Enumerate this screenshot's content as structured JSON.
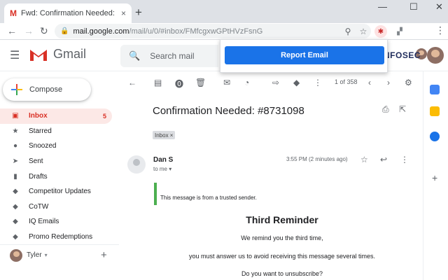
{
  "browser": {
    "tab_title": "Fwd: Confirmation Needed: tyler",
    "tab_close": "×",
    "new_tab": "+",
    "window_controls": {
      "minimize": "—",
      "maximize": "☐",
      "close": "✕"
    },
    "url_host": "mail.google.com",
    "url_path": "/mail/u/0/#inbox/FMfcgxwGPtHVzFsnG"
  },
  "gmail": {
    "brand": "Gmail",
    "search_placeholder": "Search mail",
    "org_logo": "NFOSEC"
  },
  "popup": {
    "button_label": "Report Email"
  },
  "compose_label": "Compose",
  "sidebar": {
    "items": [
      {
        "label": "Inbox",
        "icon": "inbox-icon",
        "count": "5",
        "active": true
      },
      {
        "label": "Starred",
        "icon": "star-icon"
      },
      {
        "label": "Snoozed",
        "icon": "clock-icon"
      },
      {
        "label": "Sent",
        "icon": "send-icon"
      },
      {
        "label": "Drafts",
        "icon": "draft-icon"
      },
      {
        "label": "Competitor Updates",
        "icon": "label-icon"
      },
      {
        "label": "CoTW",
        "icon": "label-icon"
      },
      {
        "label": "IQ Emails",
        "icon": "label-icon"
      },
      {
        "label": "Promo Redemptions",
        "icon": "label-icon"
      }
    ],
    "user_name": "Tyler",
    "user_caret": "▾",
    "add_label": "+"
  },
  "message": {
    "pager": "1 of 358",
    "subject": "Confirmation Needed:  #8731098",
    "label_chip": "Inbox ×",
    "sender": "Dan S",
    "to_me": "to me ▾",
    "time": "3:55 PM (2 minutes ago)",
    "trusted_notice": "This message is from a trusted sender.",
    "heading": "Third Reminder",
    "line1": "We remind you the third time,",
    "line2": "you must answer us to avoid receiving this message several times.",
    "line3": "Do you want to unsubscribe?"
  },
  "colors": {
    "accent_blue": "#1a73e8",
    "gmail_red": "#d93025",
    "trusted_green": "#4caf50",
    "inbox_active_bg": "#fce8e6"
  }
}
